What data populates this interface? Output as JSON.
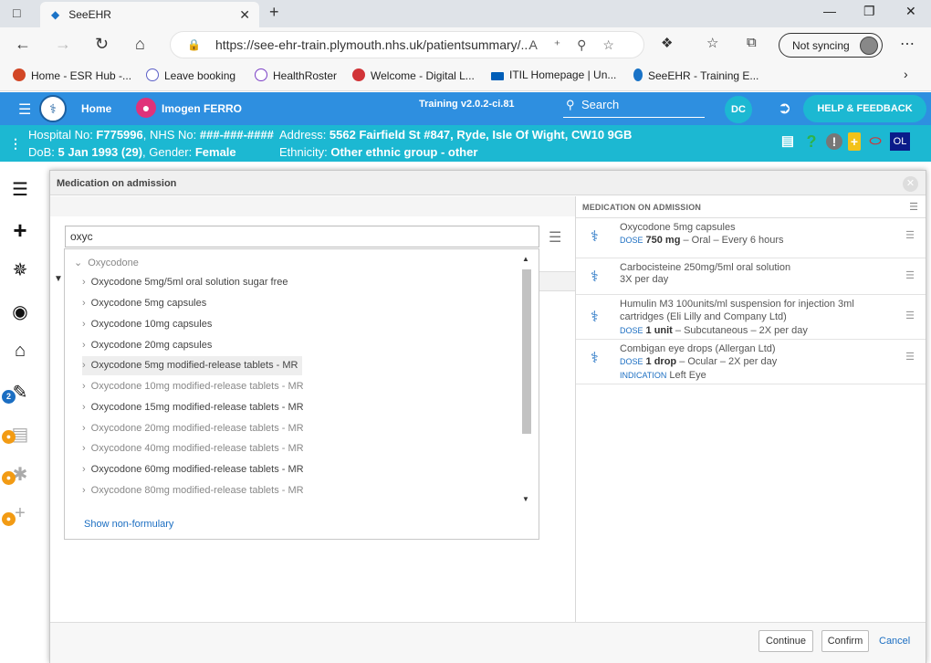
{
  "browser": {
    "tab_title": "SeeEHR",
    "url": "https://see-ehr-train.plymouth.nhs.uk/patientsummary/...",
    "sync_label": "Not syncing",
    "favorites": [
      {
        "label": "Home - ESR Hub -...",
        "color": "#d24726"
      },
      {
        "label": "Leave booking",
        "color": "#5b5fc7"
      },
      {
        "label": "HealthRoster",
        "color": "#7b3fc6"
      },
      {
        "label": "Welcome - Digital L...",
        "color": "#d13438"
      },
      {
        "label": "ITIL Homepage | Un...",
        "color": "#005eb8"
      },
      {
        "label": "SeeEHR - Training E...",
        "color": "#1a73c7"
      }
    ]
  },
  "app": {
    "home_label": "Home",
    "patient_name": "Imogen FERRO",
    "version": "Training v2.0.2-ci.81",
    "search_label": "Search",
    "user_initials": "DC",
    "help_label": "HELP & FEEDBACK"
  },
  "demographics": {
    "hospital_label": "Hospital No: ",
    "hospital_no": "F775996",
    "nhs_label": ", NHS No: ",
    "nhs_no": "###-###-####",
    "address_label": "Address: ",
    "address": "5562 Fairfield St #847, Ryde, Isle Of Wight, CW10 9GB",
    "dob_label": "DoB: ",
    "dob": "5 Jan 1993 (29)",
    "gender_label": ", Gender: ",
    "gender": "Female",
    "ethnicity_label": "Ethnicity: ",
    "ethnicity": "Other ethnic group - other",
    "badge": "OL"
  },
  "sidebar": {
    "badge_count": "2"
  },
  "modal": {
    "title": "Medication on admission",
    "search_value": "oxyc",
    "group_label": "Oxycodone",
    "results": [
      {
        "label": "Oxycodone 5mg/5ml oral solution sugar free",
        "dim": false
      },
      {
        "label": "Oxycodone 5mg capsules",
        "dim": false
      },
      {
        "label": "Oxycodone 10mg capsules",
        "dim": false
      },
      {
        "label": "Oxycodone 20mg capsules",
        "dim": false
      },
      {
        "label": "Oxycodone 5mg modified-release tablets - MR",
        "dim": false
      },
      {
        "label": "Oxycodone 10mg modified-release tablets - MR",
        "dim": true
      },
      {
        "label": "Oxycodone 15mg modified-release tablets - MR",
        "dim": false
      },
      {
        "label": "Oxycodone 20mg modified-release tablets - MR",
        "dim": true
      },
      {
        "label": "Oxycodone 40mg modified-release tablets - MR",
        "dim": true
      },
      {
        "label": "Oxycodone 60mg modified-release tablets - MR",
        "dim": false
      },
      {
        "label": "Oxycodone 80mg modified-release tablets - MR",
        "dim": true
      }
    ],
    "show_nonformulary": "Show non-formulary",
    "right_title": "MEDICATION ON ADMISSION",
    "medications": [
      {
        "name": "Oxycodone 5mg capsules",
        "dose_label": "DOSE",
        "dose": "750 mg",
        "detail": " – Oral – Every 6 hours"
      },
      {
        "name": "Carbocisteine 250mg/5ml oral solution",
        "detail_plain": "3X per day"
      },
      {
        "name": "Humulin M3 100units/ml suspension for injection 3ml cartridges (Eli Lilly and Company Ltd)",
        "dose_label": "DOSE",
        "dose": "1 unit",
        "detail": " – Subcutaneous – 2X per day"
      },
      {
        "name": "Combigan eye drops (Allergan Ltd)",
        "dose_label": "DOSE",
        "dose": "1 drop",
        "detail": " – Ocular – 2X per day",
        "indication_label": "INDICATION",
        "indication": "Left Eye"
      }
    ],
    "buttons": {
      "continue": "Continue",
      "confirm": "Confirm",
      "cancel": "Cancel"
    }
  }
}
